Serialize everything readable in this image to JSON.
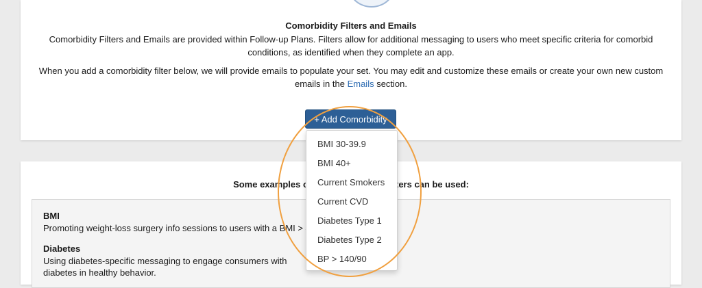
{
  "top_section": {
    "title": "Comorbidity Filters and Emails",
    "paragraph1": "Comorbidity Filters and Emails are provided within Follow-up Plans. Filters allow for additional messaging to users who meet specific criteria for comorbid conditions, as identified when they complete an app.",
    "paragraph2_before": "When you add a comorbidity filter below, we will provide emails to populate your set. You may edit and customize these emails or create your own new custom emails in the ",
    "paragraph2_link": "Emails",
    "paragraph2_after": " section.",
    "add_button_label": "+ Add Comorbidity"
  },
  "dropdown": {
    "items": [
      "BMI 30-39.9",
      "BMI 40+",
      "Current Smokers",
      "Current CVD",
      "Diabetes Type 1",
      "Diabetes Type 2",
      "BP > 140/90"
    ]
  },
  "examples_section": {
    "heading": "Some examples of how comorbidity filters can be used:",
    "examples": [
      {
        "title": "BMI",
        "text": "Promoting weight-loss surgery info sessions to users with a BMI > 40."
      },
      {
        "title": "Diabetes",
        "text": "Using diabetes-specific messaging to engage consumers with diabetes in healthy behavior."
      }
    ]
  },
  "colors": {
    "button_bg": "#2d5f96",
    "link": "#2f6db3",
    "annotation": "#f0a040"
  }
}
